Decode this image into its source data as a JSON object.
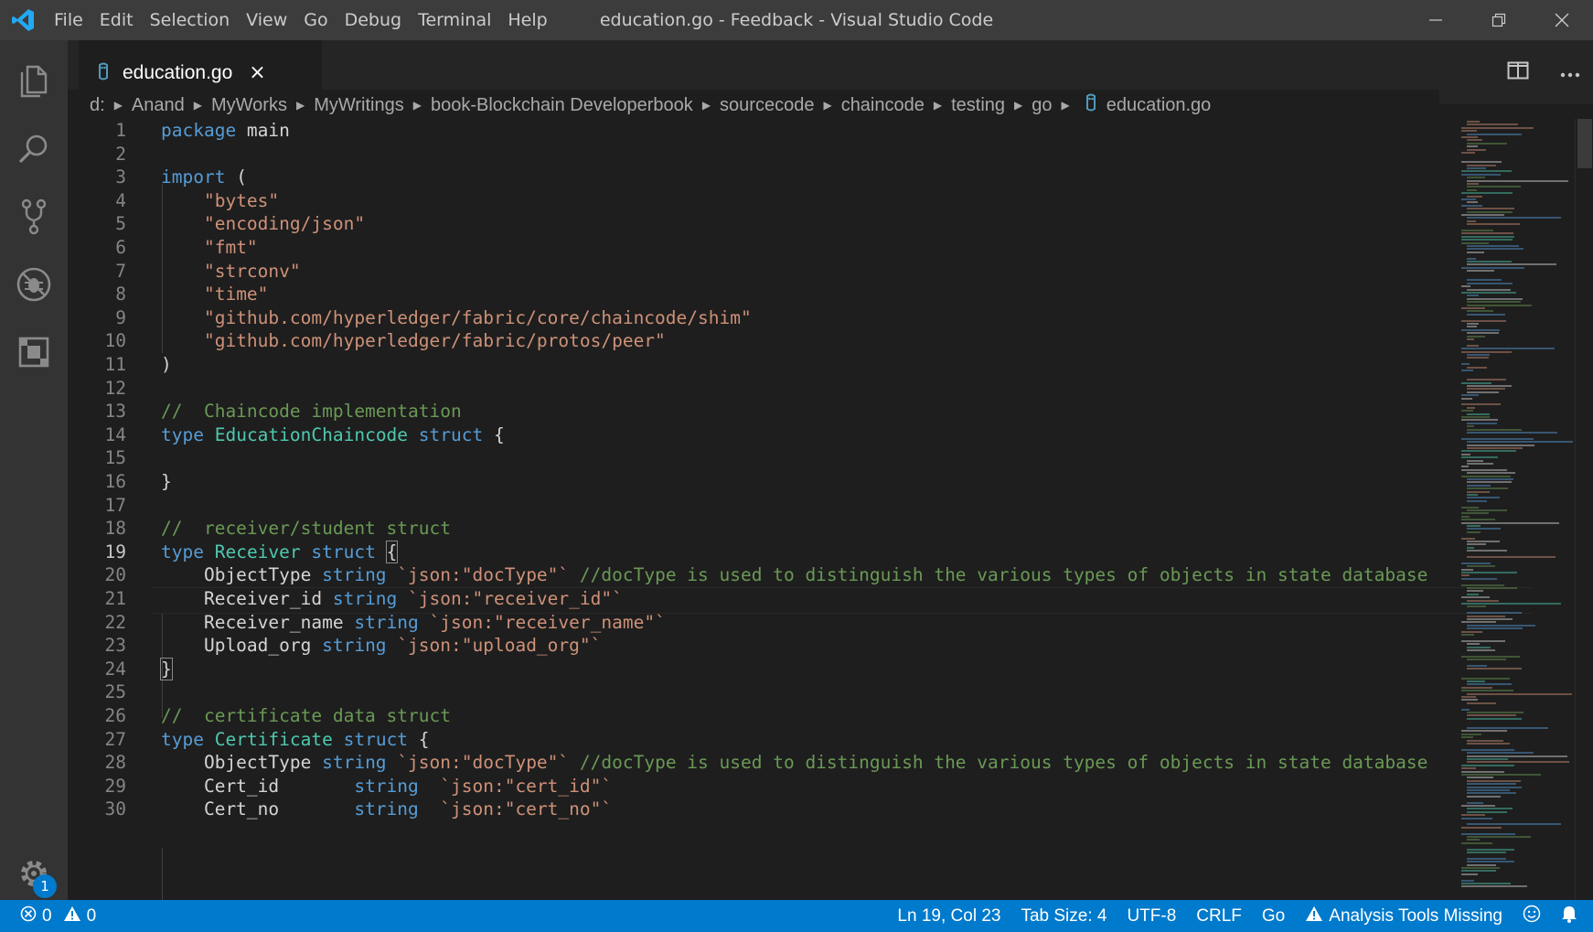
{
  "window": {
    "title": "education.go - Feedback - Visual Studio Code"
  },
  "menu": [
    "File",
    "Edit",
    "Selection",
    "View",
    "Go",
    "Debug",
    "Terminal",
    "Help"
  ],
  "tab": {
    "label": "education.go",
    "close": "×"
  },
  "breadcrumb": [
    "d:",
    "Anand",
    "MyWorks",
    "MyWritings",
    "book-Blockchain Developerbook",
    "sourcecode",
    "chaincode",
    "testing",
    "go",
    "education.go"
  ],
  "editor": {
    "active_line": 19,
    "lines": [
      {
        "n": "1",
        "tokens": [
          {
            "c": "k",
            "t": "package"
          },
          {
            "c": "p",
            "t": " main"
          }
        ]
      },
      {
        "n": "2",
        "tokens": []
      },
      {
        "n": "3",
        "tokens": [
          {
            "c": "k",
            "t": "import"
          },
          {
            "c": "p",
            "t": " ("
          }
        ]
      },
      {
        "n": "4",
        "tokens": [
          {
            "c": "p",
            "t": "    "
          },
          {
            "c": "s",
            "t": "\"bytes\""
          }
        ]
      },
      {
        "n": "5",
        "tokens": [
          {
            "c": "p",
            "t": "    "
          },
          {
            "c": "s",
            "t": "\"encoding/json\""
          }
        ]
      },
      {
        "n": "6",
        "tokens": [
          {
            "c": "p",
            "t": "    "
          },
          {
            "c": "s",
            "t": "\"fmt\""
          }
        ]
      },
      {
        "n": "7",
        "tokens": [
          {
            "c": "p",
            "t": "    "
          },
          {
            "c": "s",
            "t": "\"strconv\""
          }
        ]
      },
      {
        "n": "8",
        "tokens": [
          {
            "c": "p",
            "t": "    "
          },
          {
            "c": "s",
            "t": "\"time\""
          }
        ]
      },
      {
        "n": "9",
        "tokens": [
          {
            "c": "p",
            "t": "    "
          },
          {
            "c": "s",
            "t": "\"github.com/hyperledger/fabric/core/chaincode/shim\""
          }
        ]
      },
      {
        "n": "10",
        "tokens": [
          {
            "c": "p",
            "t": "    "
          },
          {
            "c": "s",
            "t": "\"github.com/hyperledger/fabric/protos/peer\""
          }
        ]
      },
      {
        "n": "11",
        "tokens": [
          {
            "c": "p",
            "t": ")"
          }
        ]
      },
      {
        "n": "12",
        "tokens": []
      },
      {
        "n": "13",
        "tokens": [
          {
            "c": "c",
            "t": "//  Chaincode implementation"
          }
        ]
      },
      {
        "n": "14",
        "tokens": [
          {
            "c": "k",
            "t": "type"
          },
          {
            "c": "p",
            "t": " "
          },
          {
            "c": "t",
            "t": "EducationChaincode"
          },
          {
            "c": "p",
            "t": " "
          },
          {
            "c": "k",
            "t": "struct"
          },
          {
            "c": "p",
            "t": " {"
          }
        ]
      },
      {
        "n": "15",
        "tokens": []
      },
      {
        "n": "16",
        "tokens": [
          {
            "c": "p",
            "t": "}"
          }
        ]
      },
      {
        "n": "17",
        "tokens": []
      },
      {
        "n": "18",
        "tokens": [
          {
            "c": "c",
            "t": "//  receiver/student struct"
          }
        ]
      },
      {
        "n": "19",
        "tokens": [
          {
            "c": "k",
            "t": "type"
          },
          {
            "c": "p",
            "t": " "
          },
          {
            "c": "t",
            "t": "Receiver"
          },
          {
            "c": "p",
            "t": " "
          },
          {
            "c": "k",
            "t": "struct"
          },
          {
            "c": "p",
            "t": " "
          },
          {
            "c": "br",
            "t": "{"
          }
        ]
      },
      {
        "n": "20",
        "tokens": [
          {
            "c": "p",
            "t": "    ObjectType "
          },
          {
            "c": "k",
            "t": "string"
          },
          {
            "c": "p",
            "t": " "
          },
          {
            "c": "s",
            "t": "`json:\"docType\"`"
          },
          {
            "c": "p",
            "t": " "
          },
          {
            "c": "c",
            "t": "//docType is used to distinguish the various types of objects in state database"
          }
        ]
      },
      {
        "n": "21",
        "tokens": [
          {
            "c": "p",
            "t": "    Receiver_id "
          },
          {
            "c": "k",
            "t": "string"
          },
          {
            "c": "p",
            "t": " "
          },
          {
            "c": "s",
            "t": "`json:\"receiver_id\"`"
          }
        ]
      },
      {
        "n": "22",
        "tokens": [
          {
            "c": "p",
            "t": "    Receiver_name "
          },
          {
            "c": "k",
            "t": "string"
          },
          {
            "c": "p",
            "t": " "
          },
          {
            "c": "s",
            "t": "`json:\"receiver_name\"`"
          }
        ]
      },
      {
        "n": "23",
        "tokens": [
          {
            "c": "p",
            "t": "    Upload_org "
          },
          {
            "c": "k",
            "t": "string"
          },
          {
            "c": "p",
            "t": " "
          },
          {
            "c": "s",
            "t": "`json:\"upload_org\"`"
          }
        ]
      },
      {
        "n": "24",
        "tokens": [
          {
            "c": "br",
            "t": "}"
          }
        ]
      },
      {
        "n": "25",
        "tokens": []
      },
      {
        "n": "26",
        "tokens": [
          {
            "c": "c",
            "t": "//  certificate data struct"
          }
        ]
      },
      {
        "n": "27",
        "tokens": [
          {
            "c": "k",
            "t": "type"
          },
          {
            "c": "p",
            "t": " "
          },
          {
            "c": "t",
            "t": "Certificate"
          },
          {
            "c": "p",
            "t": " "
          },
          {
            "c": "k",
            "t": "struct"
          },
          {
            "c": "p",
            "t": " {"
          }
        ]
      },
      {
        "n": "28",
        "tokens": [
          {
            "c": "p",
            "t": "    ObjectType "
          },
          {
            "c": "k",
            "t": "string"
          },
          {
            "c": "p",
            "t": " "
          },
          {
            "c": "s",
            "t": "`json:\"docType\"`"
          },
          {
            "c": "p",
            "t": " "
          },
          {
            "c": "c",
            "t": "//docType is used to distinguish the various types of objects in state database"
          }
        ]
      },
      {
        "n": "29",
        "tokens": [
          {
            "c": "p",
            "t": "    Cert_id       "
          },
          {
            "c": "k",
            "t": "string"
          },
          {
            "c": "p",
            "t": "  "
          },
          {
            "c": "s",
            "t": "`json:\"cert_id\"`"
          }
        ]
      },
      {
        "n": "30",
        "tokens": [
          {
            "c": "p",
            "t": "    Cert_no       "
          },
          {
            "c": "k",
            "t": "string"
          },
          {
            "c": "p",
            "t": "  "
          },
          {
            "c": "s",
            "t": "`json:\"cert_no\"`"
          }
        ]
      }
    ]
  },
  "activity": {
    "settings_badge": "1"
  },
  "status": {
    "errors": "0",
    "warnings": "0",
    "position": "Ln 19, Col 23",
    "tab_size": "Tab Size: 4",
    "encoding": "UTF-8",
    "eol": "CRLF",
    "language": "Go",
    "analysis": "Analysis Tools Missing"
  },
  "colors": {
    "statusbar": "#007acc",
    "keyword": "#569cd6",
    "type": "#4ec9b0",
    "string": "#ce9178",
    "comment": "#6a9955"
  },
  "icons": [
    "vscode-logo-icon",
    "explorer-icon",
    "search-icon",
    "source-control-icon",
    "debug-icon",
    "extensions-icon",
    "settings-gear-icon",
    "go-file-icon",
    "split-editor-icon",
    "more-actions-icon",
    "minimize-icon",
    "restore-icon",
    "close-window-icon",
    "error-icon",
    "warning-icon",
    "smiley-icon",
    "bell-icon"
  ]
}
